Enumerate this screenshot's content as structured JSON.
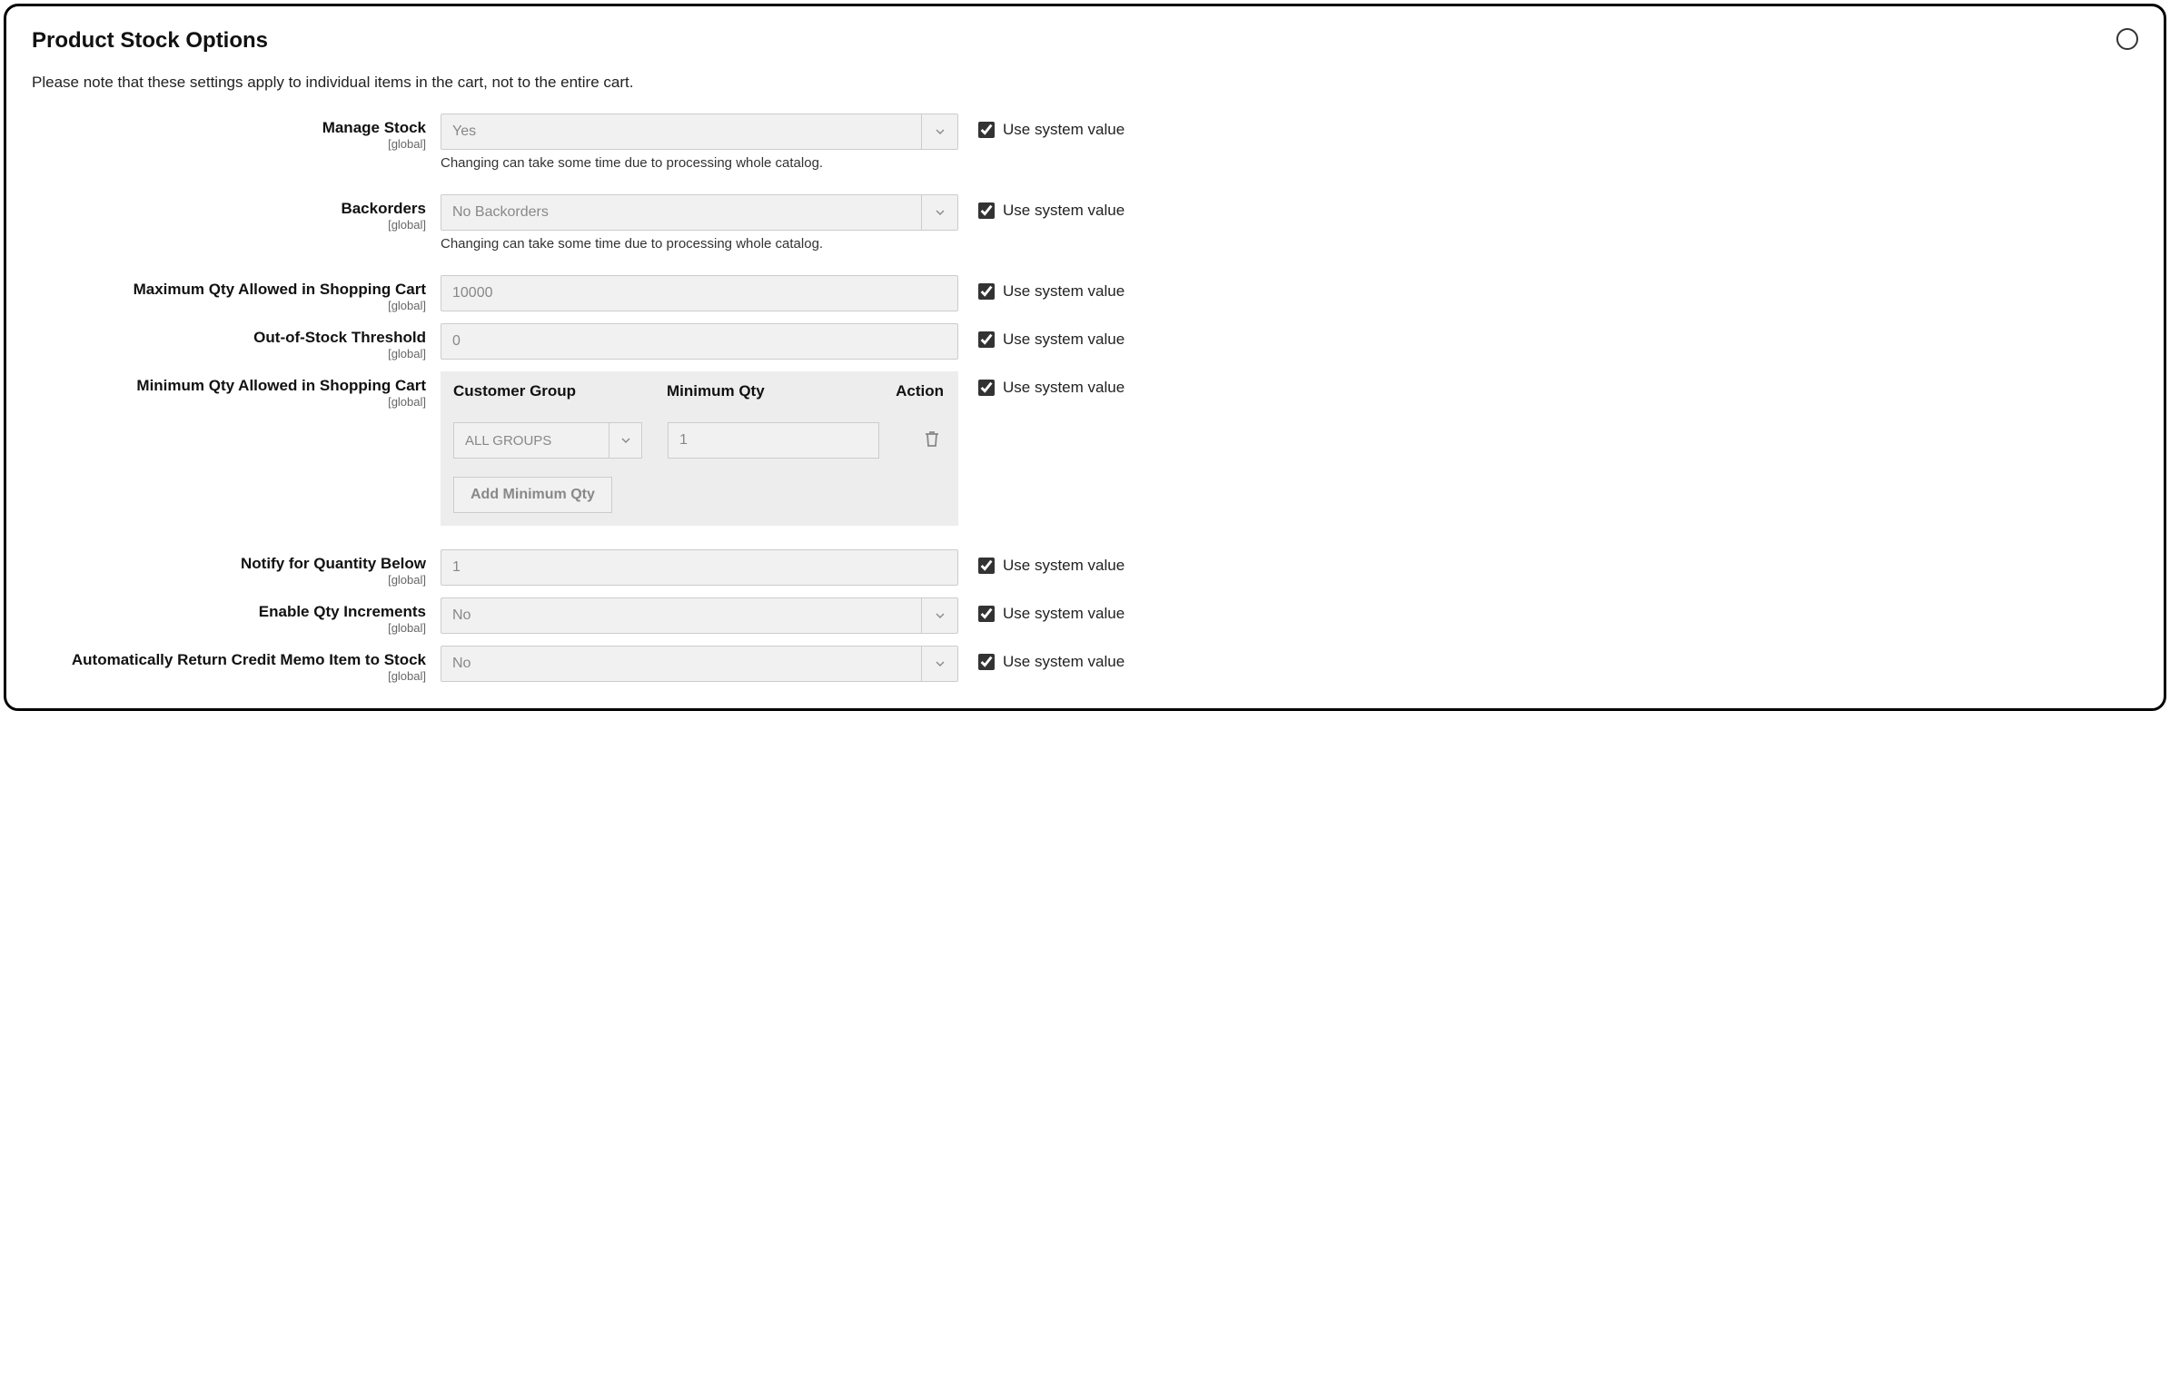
{
  "section": {
    "title": "Product Stock Options",
    "note": "Please note that these settings apply to individual items in the cart, not to the entire cart."
  },
  "use_system_label": "Use system value",
  "scope_global": "[global]",
  "catalog_hint": "Changing can take some time due to processing whole catalog.",
  "fields": {
    "manage_stock": {
      "label": "Manage Stock",
      "value": "Yes"
    },
    "backorders": {
      "label": "Backorders",
      "value": "No Backorders"
    },
    "max_qty": {
      "label": "Maximum Qty Allowed in Shopping Cart",
      "value": "10000"
    },
    "oos_threshold": {
      "label": "Out-of-Stock Threshold",
      "value": "0"
    },
    "min_qty": {
      "label": "Minimum Qty Allowed in Shopping Cart",
      "cols": {
        "group": "Customer Group",
        "qty": "Minimum Qty",
        "action": "Action"
      },
      "row": {
        "group": "ALL GROUPS",
        "qty": "1"
      },
      "add_btn": "Add Minimum Qty"
    },
    "notify_below": {
      "label": "Notify for Quantity Below",
      "value": "1"
    },
    "enable_incr": {
      "label": "Enable Qty Increments",
      "value": "No"
    },
    "auto_return": {
      "label": "Automatically Return Credit Memo Item to Stock",
      "value": "No"
    }
  }
}
